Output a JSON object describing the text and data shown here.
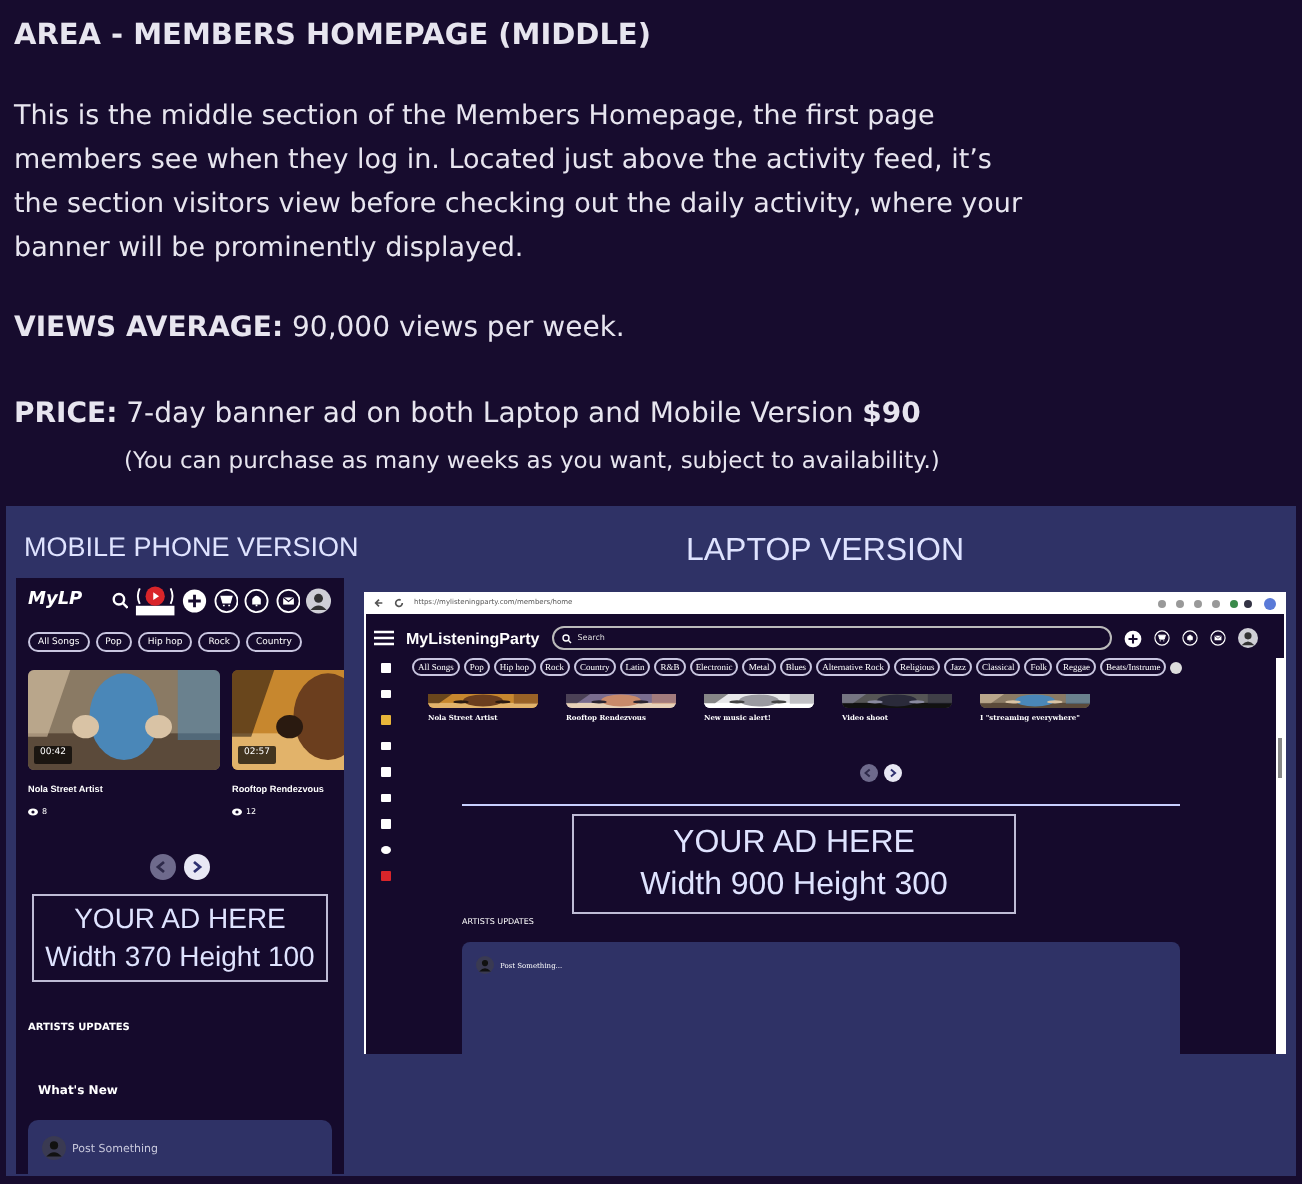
{
  "heading": "AREA - MEMBERS HOMEPAGE (MIDDLE)",
  "description": "This is the middle section of the Members Homepage, the first page members see when they log in. Located just above the activity feed, it’s the section visitors view before checking out the daily activity, where your banner will be prominently displayed.",
  "views": "**VIEWS AVERAGE:** 90,000 views per week.",
  "price": "**PRICE:** 7-day banner ad on both Laptop and Mobile Version **$90**",
  "price_note": "(You can purchase as many weeks as you want, subject to availability.)",
  "mobile": {
    "label": "MOBILE PHONE VERSION",
    "logo": "MyLP",
    "genres": [
      "All Songs",
      "Pop",
      "Hip hop",
      "Rock",
      "Country"
    ],
    "videos": [
      {
        "duration": "00:42",
        "title": "Nola Street Artist",
        "views": "8"
      },
      {
        "duration": "02:57",
        "title": "Rooftop Rendezvous",
        "views": "12"
      }
    ],
    "carousel": [
      {
        "kind": "prev",
        "disabled": true
      },
      {
        "kind": "next",
        "disabled": false
      }
    ],
    "ad": [
      "YOUR AD HERE",
      "Width 370 Height 100"
    ],
    "section": "ARTISTS UPDATES",
    "whats_new": "What's New",
    "post": "Post Something"
  },
  "laptop": {
    "label": "LAPTOP VERSION",
    "url": "https://mylisteningparty.com/members/home",
    "logo": "MyListeningParty",
    "search_placeholder": "Search",
    "genres": [
      "All Songs",
      "Pop",
      "Hip hop",
      "Rock",
      "Country",
      "Latin",
      "R&B",
      "Electronic",
      "Metal",
      "Blues",
      "Alternative Rock",
      "Religious",
      "Jazz",
      "Classical",
      "Folk",
      "Reggae",
      "Beats/Instrume"
    ],
    "videos": [
      {
        "title": "Nola Street Artist"
      },
      {
        "title": "Rooftop Rendezvous"
      },
      {
        "title": "New music alert!"
      },
      {
        "title": "Video shoot"
      },
      {
        "title": "I \"streaming everywhere\""
      }
    ],
    "carousel": [
      {
        "kind": "prev",
        "disabled": true
      },
      {
        "kind": "next",
        "disabled": false
      }
    ],
    "ad": [
      "YOUR AD HERE",
      "Width 900 Height 300"
    ],
    "section": "ARTISTS UPDATES",
    "post": "Post Something..."
  }
}
